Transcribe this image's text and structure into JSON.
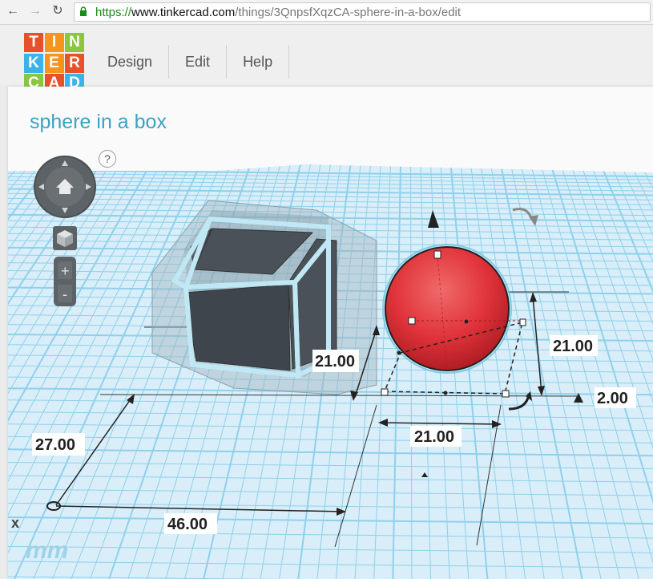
{
  "browser": {
    "url_protocol": "https://",
    "url_host": "www.tinkercad.com",
    "url_path": "/things/3QnpsfXqzCA-sphere-in-a-box/edit",
    "back_icon": "arrow-left-icon",
    "forward_icon": "arrow-right-icon",
    "reload_icon": "reload-icon"
  },
  "logo": {
    "letters": [
      "T",
      "I",
      "N",
      "K",
      "E",
      "R",
      "C",
      "A",
      "D"
    ],
    "colors": [
      "#e8502a",
      "#f7941e",
      "#8cc63f",
      "#3ab4e8",
      "#f7941e",
      "#e8502a",
      "#8cc63f",
      "#e8502a",
      "#3ab4e8"
    ]
  },
  "menu": {
    "design": "Design",
    "edit": "Edit",
    "help": "Help"
  },
  "design": {
    "title": "sphere in a box"
  },
  "help_label": "?",
  "view_controls": {
    "zoom_in": "+",
    "zoom_out": "-",
    "home_icon": "home-icon",
    "orbit_icon": "orbit-arrows-icon",
    "view_cube_icon": "view-cube-icon"
  },
  "dimensions": {
    "box_depth": "21.00",
    "sphere_height": "21.00",
    "sphere_width": "21.00",
    "sphere_elevation": "2.00",
    "position_y": "27.00",
    "position_x": "46.00"
  },
  "units": "mm",
  "colors": {
    "grid": "#7ec8e8",
    "sphere": "#e0323a",
    "accent": "#3aa3c4"
  }
}
